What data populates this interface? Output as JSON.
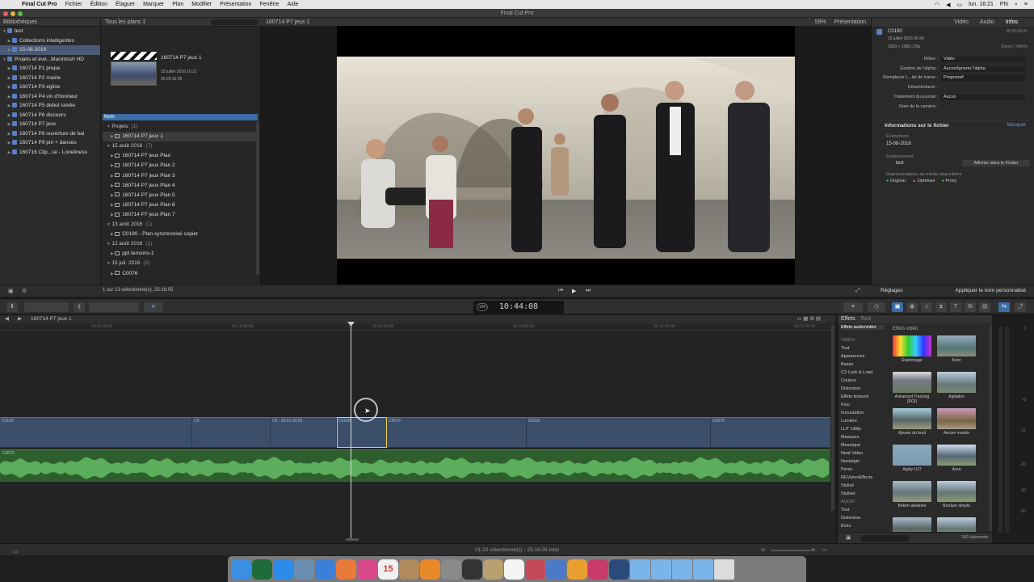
{
  "menubar": {
    "apple": "",
    "menus": [
      "Final Cut Pro",
      "Fichier",
      "Édition",
      "Élaguer",
      "Marquer",
      "Plan",
      "Modifier",
      "Présentation",
      "Fenêtre",
      "Aide"
    ],
    "clock": "lun. 16:21",
    "user": "Phi"
  },
  "window_title": "Final Cut Pro",
  "libraries": {
    "header": "Bibliothèques",
    "items": [
      {
        "label": "test",
        "level": 0,
        "open": true
      },
      {
        "label": "Collections intelligentes",
        "level": 1,
        "open": false
      },
      {
        "label": "15-08-2016",
        "level": 1,
        "open": false,
        "selected": true
      },
      {
        "label": "Projets et évé...Macintosh HD",
        "level": 0,
        "open": true
      },
      {
        "label": "160714 P1 prepa",
        "level": 1,
        "open": false
      },
      {
        "label": "160714 P2 mairie",
        "level": 1,
        "open": false
      },
      {
        "label": "160714 P3 eglise",
        "level": 1,
        "open": false
      },
      {
        "label": "160714 P4 vin d'honneur",
        "level": 1,
        "open": false
      },
      {
        "label": "160714 P5 debut soirée",
        "level": 1,
        "open": false
      },
      {
        "label": "160714 P6 discours",
        "level": 1,
        "open": false
      },
      {
        "label": "160714 P7 jeux",
        "level": 1,
        "open": false
      },
      {
        "label": "160714 P8 ouverture de bal",
        "level": 1,
        "open": false
      },
      {
        "label": "160714 P9 pm + danses",
        "level": 1,
        "open": false
      },
      {
        "label": "160716 Clip...se - Loneliness",
        "level": 1,
        "open": false
      }
    ]
  },
  "browser": {
    "filter": "Tous les plans ‡",
    "thumb_title": "160714 P7 jeux 1",
    "thumb_date": "15 juillet 2016 16:21",
    "thumb_duration": "00:25:16:05",
    "column_name": "Nom",
    "rows": [
      {
        "label": "Projets",
        "count": "(1)",
        "indent": 0,
        "group": true
      },
      {
        "label": "160714 P7 jeux 1",
        "count": "",
        "indent": 1,
        "selected": true
      },
      {
        "label": "15 août 2016",
        "count": "(7)",
        "indent": 0,
        "group": true
      },
      {
        "label": "160714 P7 jeux Plan",
        "count": "",
        "indent": 1
      },
      {
        "label": "160714 P7 jeux Plan 2",
        "count": "",
        "indent": 1
      },
      {
        "label": "160714 P7 jeux Plan 3",
        "count": "",
        "indent": 1
      },
      {
        "label": "160714 P7 jeux Plan 4",
        "count": "",
        "indent": 1
      },
      {
        "label": "160714 P7 jeux Plan 5",
        "count": "",
        "indent": 1
      },
      {
        "label": "160714 P7 jeux Plan 6",
        "count": "",
        "indent": 1
      },
      {
        "label": "160714 P7 jeux Plan 7",
        "count": "",
        "indent": 1
      },
      {
        "label": "13 août 2016",
        "count": "(1)",
        "indent": 0,
        "group": true
      },
      {
        "label": "C0190 - Plan synchronisé copier",
        "count": "",
        "indent": 1
      },
      {
        "label": "12 août 2016",
        "count": "(1)",
        "indent": 0,
        "group": true
      },
      {
        "label": "ppt temoins-1",
        "count": "",
        "indent": 1
      },
      {
        "label": "15 juil. 2016",
        "count": "(2)",
        "indent": 0,
        "group": true
      },
      {
        "label": "C0076",
        "count": "",
        "indent": 1
      }
    ],
    "footer": "1 sur 13 sélectionné(s), 25:16:05"
  },
  "viewer": {
    "title": "160714 P7 jeux 1",
    "zoom": "59%",
    "view_menu": "Présentation"
  },
  "inspector": {
    "tabs": [
      "Vidéo",
      "Audio",
      "Infos"
    ],
    "active_tab": "Infos",
    "clip_name": "C0190",
    "clip_date": "15 juillet 2016 00:34",
    "clip_format": "1920 × 1080 | 25p",
    "clip_duration": "00:00:00:20",
    "clip_audio": "Stéréo | 48kHz",
    "fields": [
      {
        "label": "Rôles :",
        "value": "Vidéo"
      },
      {
        "label": "Gestion de l'alpha :",
        "value": "Aucun/Ignorer l'alpha"
      },
      {
        "label": "Remplacer L...ité de trame :",
        "value": "Progressif"
      },
      {
        "label": "Désentrelacer :",
        "value": ""
      },
      {
        "label": "Traitement du journal :",
        "value": "Aucun"
      },
      {
        "label": "Nom de la caméra :",
        "value": ""
      }
    ],
    "file_info_title": "Informations sur le fichier",
    "hide_label": "Masquer",
    "event_label": "Événement",
    "event_value": "15-08-2016",
    "location_label": "Emplacement",
    "location_value": "test",
    "show_finder": "Afficher dans le Finder",
    "reps_label": "Représentations du média disponibles",
    "reps": [
      "Original",
      "Optimisé",
      "Proxy"
    ],
    "footer_left": "Réglages",
    "footer_right": "Appliquer le nom personnalisé"
  },
  "toolbar": {
    "timecode": "10:44:08",
    "badge": "100"
  },
  "timeline": {
    "project": "160714 P7 jeux 1",
    "ticks": [
      "00:10:30:00",
      "00:10:40:00",
      "00:10:45:00",
      "00:10:50:00",
      "00:10:55:00",
      "00:11:00:00"
    ],
    "clips": [
      "C0190",
      "C0",
      "C0 - 00:01:10:03",
      "C0190",
      "C0076",
      "C0190",
      "C0076"
    ],
    "audio_clip": "C0076"
  },
  "effects": {
    "title": "Effets",
    "all_label": "Tout",
    "cat_title": "Effets audio/vidéo",
    "grid_title": "Effets vidéo",
    "categories": [
      "VIDÉO",
      "Tout",
      "Apparences",
      "Bases",
      "C2 Lock & Load",
      "Couleur",
      "Distorsion",
      "Effets textuels",
      "Flou",
      "Incrustation",
      "Lumière",
      "LUT Utility",
      "Masques",
      "Mosaïque",
      "Neat Video",
      "Nostalgie",
      "Perso",
      "REVisionEffects",
      "Stylisé",
      "Styliser",
      "AUDIO",
      "Tout",
      "Distorsion",
      "Écho"
    ],
    "items": [
      "Étalonnage",
      "Acier",
      "Advanced Tracking [ROI]",
      "Agitation",
      "Ajouter du bruit",
      "Ancien monde",
      "Apply LUT",
      "Aura",
      "Bokeh aléatoire",
      "Bordure simple",
      "",
      ""
    ],
    "count": "243 éléments"
  },
  "meters": {
    "labels": [
      "0",
      "-6",
      "-12",
      "-20",
      "-30",
      "-50"
    ]
  },
  "status": {
    "text": "01:20 sélectionné(s) - 25:16:05 total"
  },
  "dock": {
    "apps": [
      {
        "name": "finder-icon",
        "color": "#3a8fe0"
      },
      {
        "name": "bootcamp-icon",
        "color": "#1f6b3a"
      },
      {
        "name": "app-store-icon",
        "color": "#2d8ce8"
      },
      {
        "name": "preview-icon",
        "color": "#6a8fb0"
      },
      {
        "name": "safari-icon",
        "color": "#3b7fd9"
      },
      {
        "name": "photos-icon",
        "color": "#e97a3a"
      },
      {
        "name": "itunes-icon",
        "color": "#d84a8a"
      },
      {
        "name": "calendar-icon",
        "color": "#f0f0f0"
      },
      {
        "name": "contacts-icon",
        "color": "#b08a5a"
      },
      {
        "name": "ibooks-icon",
        "color": "#e88a2a"
      },
      {
        "name": "system-preferences-icon",
        "color": "#8a8a8a"
      },
      {
        "name": "final-cut-icon",
        "color": "#333333"
      },
      {
        "name": "motion-icon",
        "color": "#b8a070"
      },
      {
        "name": "home-icon",
        "color": "#f5f5f5"
      },
      {
        "name": "compressor-icon",
        "color": "#c44a5a"
      },
      {
        "name": "keynote-icon",
        "color": "#4a7ac8"
      },
      {
        "name": "vlc-icon",
        "color": "#e8a030"
      },
      {
        "name": "davinci-icon",
        "color": "#c83a6a"
      },
      {
        "name": "quicktime-icon",
        "color": "#2a4a7a"
      },
      {
        "name": "folder-icon",
        "color": "#7ab4e8"
      },
      {
        "name": "folder-icon",
        "color": "#7ab4e8"
      },
      {
        "name": "folder-icon",
        "color": "#7ab4e8"
      },
      {
        "name": "folder-icon",
        "color": "#7ab4e8"
      },
      {
        "name": "trash-icon",
        "color": "#dcdcdc"
      }
    ],
    "calendar_day": "15"
  }
}
